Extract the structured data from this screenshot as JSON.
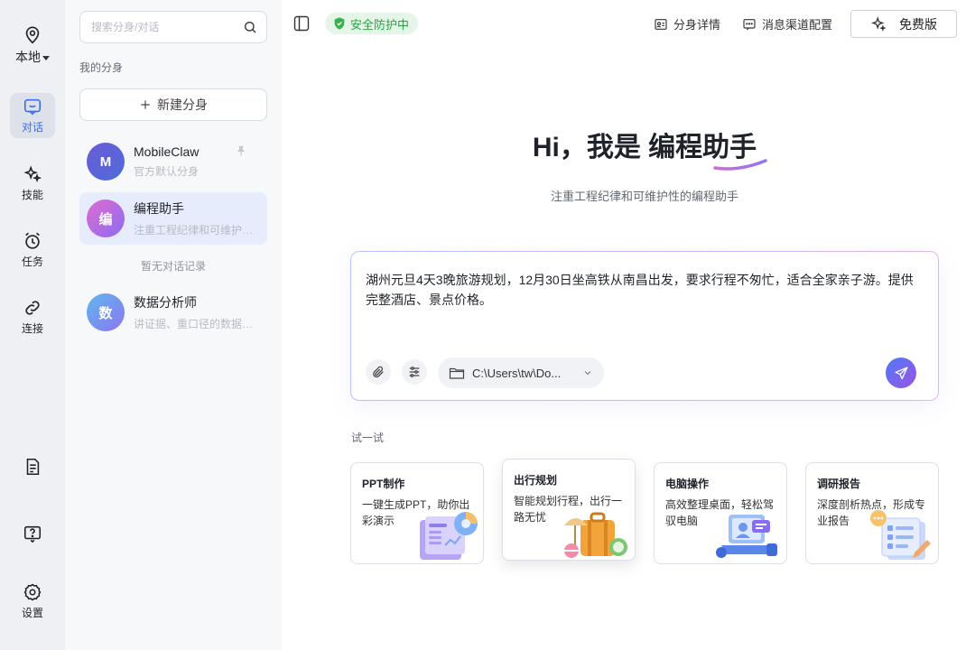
{
  "rail": {
    "location_label": "本地",
    "items": [
      {
        "label": "对话",
        "icon": "chat-icon",
        "active": true
      },
      {
        "label": "技能",
        "icon": "sparkle-icon",
        "active": false
      },
      {
        "label": "任务",
        "icon": "alarm-clock-icon",
        "active": false
      },
      {
        "label": "连接",
        "icon": "link-icon",
        "active": false
      }
    ],
    "settings_label": "设置"
  },
  "panel": {
    "search_placeholder": "搜索分身/对话",
    "section_label": "我的分身",
    "new_button": "新建分身",
    "agents": [
      {
        "initial": "M",
        "name": "MobileClaw",
        "desc": "官方默认分身",
        "color_from": "#6b5bd6",
        "color_to": "#4f6cd9",
        "pinned": true
      },
      {
        "initial": "编",
        "name": "编程助手",
        "desc": "注重工程纪律和可维护性的编程助手",
        "color_from": "#e06bd2",
        "color_to": "#8b6cf0",
        "active": true
      },
      {
        "initial": "数",
        "name": "数据分析师",
        "desc": "讲证据、重口径的数据分析师",
        "color_from": "#5fb7f0",
        "color_to": "#8b76ee"
      }
    ],
    "empty_note": "暂无对话记录"
  },
  "header": {
    "security_badge": "安全防护中",
    "agent_details": "分身详情",
    "channel_config": "消息渠道配置",
    "plan": "免费版"
  },
  "hero": {
    "greeting": "Hi，我是",
    "agent_name": "编程助手",
    "subtitle": "注重工程纪律和可维护性的编程助手"
  },
  "composer": {
    "prompt": "湖州元旦4天3晚旅游规划，12月30日坐高铁从南昌出发，要求行程不匆忙，适合全家亲子游。提供完整酒店、景点价格。",
    "path": "C:\\Users\\tw\\Do..."
  },
  "try": {
    "label": "试一试",
    "cards": [
      {
        "title": "PPT制作",
        "desc": "一键生成PPT，助你出彩演示",
        "illus": "ppt-illustration"
      },
      {
        "title": "出行规划",
        "desc": "智能规划行程，出行一路无忧",
        "illus": "travel-illustration"
      },
      {
        "title": "电脑操作",
        "desc": "高效整理桌面，轻松驾驭电脑",
        "illus": "computer-illustration"
      },
      {
        "title": "调研报告",
        "desc": "深度剖析热点，形成专业报告",
        "illus": "report-illustration"
      }
    ]
  },
  "colors": {
    "accent": "#3d6df2",
    "safe_green": "#27a343"
  }
}
